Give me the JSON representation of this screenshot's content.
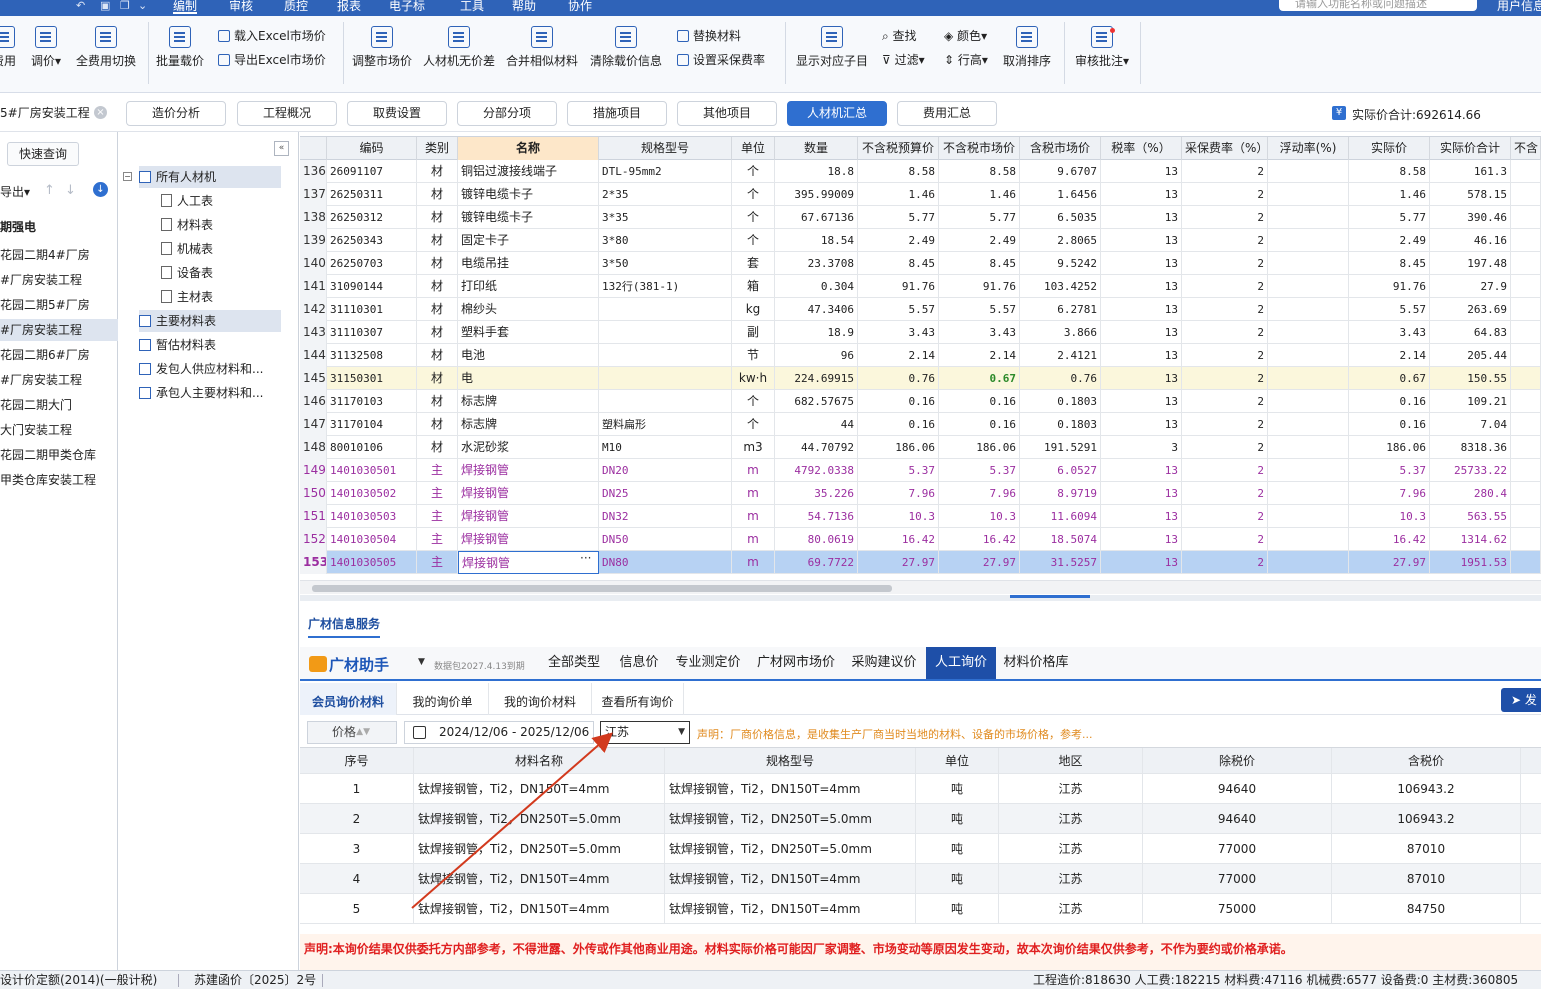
{
  "menu": {
    "items": [
      "编制",
      "审核",
      "质控",
      "报表",
      "电子标",
      "工具",
      "帮助",
      "协作"
    ],
    "search_placeholder": "请输入功能名称或问题描述",
    "user": "用户信息"
  },
  "ribbon": {
    "apply": "费用",
    "adjust_price": "调价",
    "switch_all_fees": "全费用切换",
    "batch_load_price": "批量载价",
    "load_excel_market": "载入Excel市场价",
    "export_excel_market": "导出Excel市场价",
    "adjust_market_price": "调整市场价",
    "lcm_no_price_diff": "人材机无价差",
    "merge_similar": "合并相似材料",
    "clear_price_info": "清除载价信息",
    "replace_material": "替换材料",
    "set_purchase_rate": "设置采保费率",
    "show_subitem": "显示对应子目",
    "find": "查找",
    "filter": "过滤",
    "color": "颜色",
    "row_height": "行高",
    "cancel_sort": "取消排序",
    "review_annotation": "审核批注"
  },
  "tabs": {
    "project_title": "5#厂房安装工程",
    "items": [
      "造价分析",
      "工程概况",
      "取费设置",
      "分部分项",
      "措施项目",
      "其他项目",
      "人材机汇总",
      "费用汇总"
    ],
    "total_label": "实际价合计:692614.66"
  },
  "left": {
    "quick_query": "快速查询",
    "export": "导出",
    "root": "期强电",
    "projects": [
      "花园二期4#厂房",
      "#厂房安装工程",
      "花园二期5#厂房",
      "#厂房安装工程",
      "花园二期6#厂房",
      "#厂房安装工程",
      "花园二期大门",
      "大门安装工程",
      "花园二期甲类仓库",
      "甲类仓库安装工程"
    ]
  },
  "tree": {
    "nodes": [
      "所有人材机",
      "人工表",
      "材料表",
      "机械表",
      "设备表",
      "主材表",
      "主要材料表",
      "暂估材料表",
      "发包人供应材料和...",
      "承包人主要材料和..."
    ]
  },
  "table": {
    "headers": [
      "编码",
      "类别",
      "名称",
      "规格型号",
      "单位",
      "数量",
      "不含税预算价",
      "不含税市场价",
      "含税市场价",
      "税率（%）",
      "采保费率（%）",
      "浮动率(%)",
      "实际价",
      "实际价合计",
      "不含"
    ],
    "rows": [
      {
        "n": "136",
        "code": "26091107",
        "type": "材",
        "name": "铜铝过渡接线端子",
        "spec": "DTL-95mm2",
        "unit": "个",
        "qty": "18.8",
        "budget": "8.58",
        "market": "8.58",
        "taxed": "9.6707",
        "tax": "13",
        "purchase": "2",
        "float": "",
        "actual": "8.58",
        "total": "161.3"
      },
      {
        "n": "137",
        "code": "26250311",
        "type": "材",
        "name": "镀锌电缆卡子",
        "spec": "2*35",
        "unit": "个",
        "qty": "395.99009",
        "budget": "1.46",
        "market": "1.46",
        "taxed": "1.6456",
        "tax": "13",
        "purchase": "2",
        "float": "",
        "actual": "1.46",
        "total": "578.15"
      },
      {
        "n": "138",
        "code": "26250312",
        "type": "材",
        "name": "镀锌电缆卡子",
        "spec": "3*35",
        "unit": "个",
        "qty": "67.67136",
        "budget": "5.77",
        "market": "5.77",
        "taxed": "6.5035",
        "tax": "13",
        "purchase": "2",
        "float": "",
        "actual": "5.77",
        "total": "390.46"
      },
      {
        "n": "139",
        "code": "26250343",
        "type": "材",
        "name": "固定卡子",
        "spec": "3*80",
        "unit": "个",
        "qty": "18.54",
        "budget": "2.49",
        "market": "2.49",
        "taxed": "2.8065",
        "tax": "13",
        "purchase": "2",
        "float": "",
        "actual": "2.49",
        "total": "46.16"
      },
      {
        "n": "140",
        "code": "26250703",
        "type": "材",
        "name": "电缆吊挂",
        "spec": "3*50",
        "unit": "套",
        "qty": "23.3708",
        "budget": "8.45",
        "market": "8.45",
        "taxed": "9.5242",
        "tax": "13",
        "purchase": "2",
        "float": "",
        "actual": "8.45",
        "total": "197.48"
      },
      {
        "n": "141",
        "code": "31090144",
        "type": "材",
        "name": "打印纸",
        "spec": "132行(381-1)",
        "unit": "箱",
        "qty": "0.304",
        "budget": "91.76",
        "market": "91.76",
        "taxed": "103.4252",
        "tax": "13",
        "purchase": "2",
        "float": "",
        "actual": "91.76",
        "total": "27.9"
      },
      {
        "n": "142",
        "code": "31110301",
        "type": "材",
        "name": "棉纱头",
        "spec": "",
        "unit": "kg",
        "qty": "47.3406",
        "budget": "5.57",
        "market": "5.57",
        "taxed": "6.2781",
        "tax": "13",
        "purchase": "2",
        "float": "",
        "actual": "5.57",
        "total": "263.69"
      },
      {
        "n": "143",
        "code": "31110307",
        "type": "材",
        "name": "塑料手套",
        "spec": "",
        "unit": "副",
        "qty": "18.9",
        "budget": "3.43",
        "market": "3.43",
        "taxed": "3.866",
        "tax": "13",
        "purchase": "2",
        "float": "",
        "actual": "3.43",
        "total": "64.83"
      },
      {
        "n": "144",
        "code": "31132508",
        "type": "材",
        "name": "电池",
        "spec": "",
        "unit": "节",
        "qty": "96",
        "budget": "2.14",
        "market": "2.14",
        "taxed": "2.4121",
        "tax": "13",
        "purchase": "2",
        "float": "",
        "actual": "2.14",
        "total": "205.44"
      },
      {
        "n": "145",
        "code": "31150301",
        "type": "材",
        "name": "电",
        "spec": "",
        "unit": "kw·h",
        "qty": "224.69915",
        "budget": "0.76",
        "market": "0.67",
        "taxed": "0.76",
        "tax": "13",
        "purchase": "2",
        "float": "",
        "actual": "0.67",
        "total": "150.55"
      },
      {
        "n": "146",
        "code": "31170103",
        "type": "材",
        "name": "标志牌",
        "spec": "",
        "unit": "个",
        "qty": "682.57675",
        "budget": "0.16",
        "market": "0.16",
        "taxed": "0.1803",
        "tax": "13",
        "purchase": "2",
        "float": "",
        "actual": "0.16",
        "total": "109.21"
      },
      {
        "n": "147",
        "code": "31170104",
        "type": "材",
        "name": "标志牌",
        "spec": "塑料扁形",
        "unit": "个",
        "qty": "44",
        "budget": "0.16",
        "market": "0.16",
        "taxed": "0.1803",
        "tax": "13",
        "purchase": "2",
        "float": "",
        "actual": "0.16",
        "total": "7.04"
      },
      {
        "n": "148",
        "code": "80010106",
        "type": "材",
        "name": "水泥砂浆",
        "spec": "M10",
        "unit": "m3",
        "qty": "44.70792",
        "budget": "186.06",
        "market": "186.06",
        "taxed": "191.5291",
        "tax": "3",
        "purchase": "2",
        "float": "",
        "actual": "186.06",
        "total": "8318.36"
      },
      {
        "n": "149",
        "code": "1401030501",
        "type": "主",
        "name": "焊接钢管",
        "spec": "DN20",
        "unit": "m",
        "qty": "4792.0338",
        "budget": "5.37",
        "market": "5.37",
        "taxed": "6.0527",
        "tax": "13",
        "purchase": "2",
        "float": "",
        "actual": "5.37",
        "total": "25733.22"
      },
      {
        "n": "150",
        "code": "1401030502",
        "type": "主",
        "name": "焊接钢管",
        "spec": "DN25",
        "unit": "m",
        "qty": "35.226",
        "budget": "7.96",
        "market": "7.96",
        "taxed": "8.9719",
        "tax": "13",
        "purchase": "2",
        "float": "",
        "actual": "7.96",
        "total": "280.4"
      },
      {
        "n": "151",
        "code": "1401030503",
        "type": "主",
        "name": "焊接钢管",
        "spec": "DN32",
        "unit": "m",
        "qty": "54.7136",
        "budget": "10.3",
        "market": "10.3",
        "taxed": "11.6094",
        "tax": "13",
        "purchase": "2",
        "float": "",
        "actual": "10.3",
        "total": "563.55"
      },
      {
        "n": "152",
        "code": "1401030504",
        "type": "主",
        "name": "焊接钢管",
        "spec": "DN50",
        "unit": "m",
        "qty": "80.0619",
        "budget": "16.42",
        "market": "16.42",
        "taxed": "18.5074",
        "tax": "13",
        "purchase": "2",
        "float": "",
        "actual": "16.42",
        "total": "1314.62"
      },
      {
        "n": "153",
        "code": "1401030505",
        "type": "主",
        "name": "焊接钢管",
        "spec": "DN80",
        "unit": "m",
        "qty": "69.7722",
        "budget": "27.97",
        "market": "27.97",
        "taxed": "31.5257",
        "tax": "13",
        "purchase": "2",
        "float": "",
        "actual": "27.97",
        "total": "1951.53"
      }
    ]
  },
  "bottom": {
    "service_title": "广材信息服务",
    "logo": "广材助手",
    "expiry": "数据包2027.4.13到期",
    "tabs": [
      "全部类型",
      "信息价",
      "专业测定价",
      "广材网市场价",
      "采购建议价",
      "人工询价",
      "材料价格库"
    ],
    "sub_tabs": [
      "会员询价材料",
      "我的询价单",
      "我的询价材料",
      "查看所有询价"
    ],
    "send": "发",
    "price_label": "价格",
    "date_range": "2024/12/06 - 2025/12/06",
    "region": "江苏",
    "declare": "声明：厂商价格信息，是收集生产厂商当时当地的材料、设备的市场价格，参考...",
    "headers": [
      "序号",
      "材料名称",
      "规格型号",
      "单位",
      "地区",
      "除税价",
      "含税价"
    ],
    "rows": [
      {
        "no": "1",
        "name": "钛焊接钢管，Ti2，DN150T=4mm",
        "spec": "钛焊接钢管，Ti2，DN150T=4mm",
        "unit": "吨",
        "region": "江苏",
        "pretax": "94640",
        "taxed": "106943.2"
      },
      {
        "no": "2",
        "name": "钛焊接钢管，Ti2，DN250T=5.0mm",
        "spec": "钛焊接钢管，Ti2，DN250T=5.0mm",
        "unit": "吨",
        "region": "江苏",
        "pretax": "94640",
        "taxed": "106943.2"
      },
      {
        "no": "3",
        "name": "钛焊接钢管，Ti2，DN250T=5.0mm",
        "spec": "钛焊接钢管，Ti2，DN250T=5.0mm",
        "unit": "吨",
        "region": "江苏",
        "pretax": "77000",
        "taxed": "87010"
      },
      {
        "no": "4",
        "name": "钛焊接钢管，Ti2，DN150T=4mm",
        "spec": "钛焊接钢管，Ti2，DN150T=4mm",
        "unit": "吨",
        "region": "江苏",
        "pretax": "77000",
        "taxed": "87010"
      },
      {
        "no": "5",
        "name": "钛焊接钢管，Ti2，DN150T=4mm",
        "spec": "钛焊接钢管，Ti2，DN150T=4mm",
        "unit": "吨",
        "region": "江苏",
        "pretax": "75000",
        "taxed": "84750"
      }
    ],
    "disclaimer": "声明:本询价结果仅供委托方内部参考，不得泄露、外传或作其他商业用途。材料实际价格可能因厂家调整、市场变动等原因发生变动，故本次询价结果仅供参考，不作为要约或价格承诺。"
  },
  "status": {
    "quota": "设计价定额(2014)(一般计税)",
    "doc": "苏建函价〔2025〕2号",
    "summary": "工程造价:818630  人工费:182215  材料费:47116  机械费:6577  设备费:0  主材费:360805"
  },
  "colors": {
    "accent": "#2f6fd0",
    "menubar": "#2f63b8",
    "main_material": "#9b2ea0",
    "warning": "#e08a1e",
    "disclaimer": "#e02020",
    "annotation": "#d23a1e"
  }
}
